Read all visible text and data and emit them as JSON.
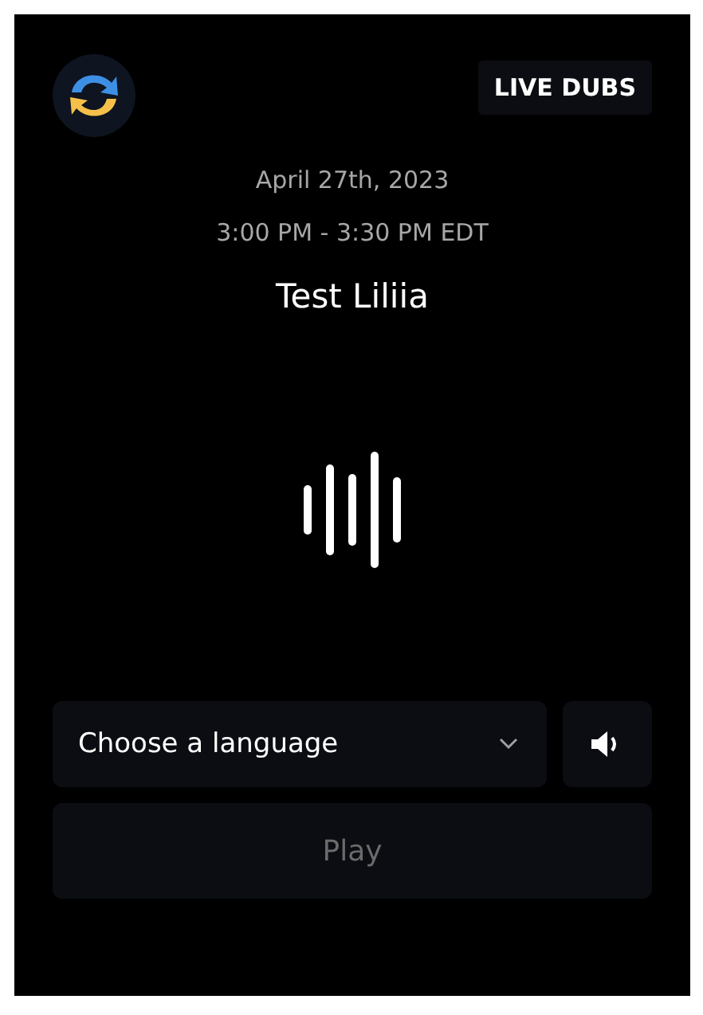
{
  "header": {
    "badge": "LIVE DUBS"
  },
  "event": {
    "date": "April 27th, 2023",
    "time": "3:00 PM - 3:30 PM EDT",
    "title": "Test Liliia"
  },
  "language_select": {
    "placeholder": "Choose a language"
  },
  "play_button": {
    "label": "Play",
    "disabled": true
  }
}
